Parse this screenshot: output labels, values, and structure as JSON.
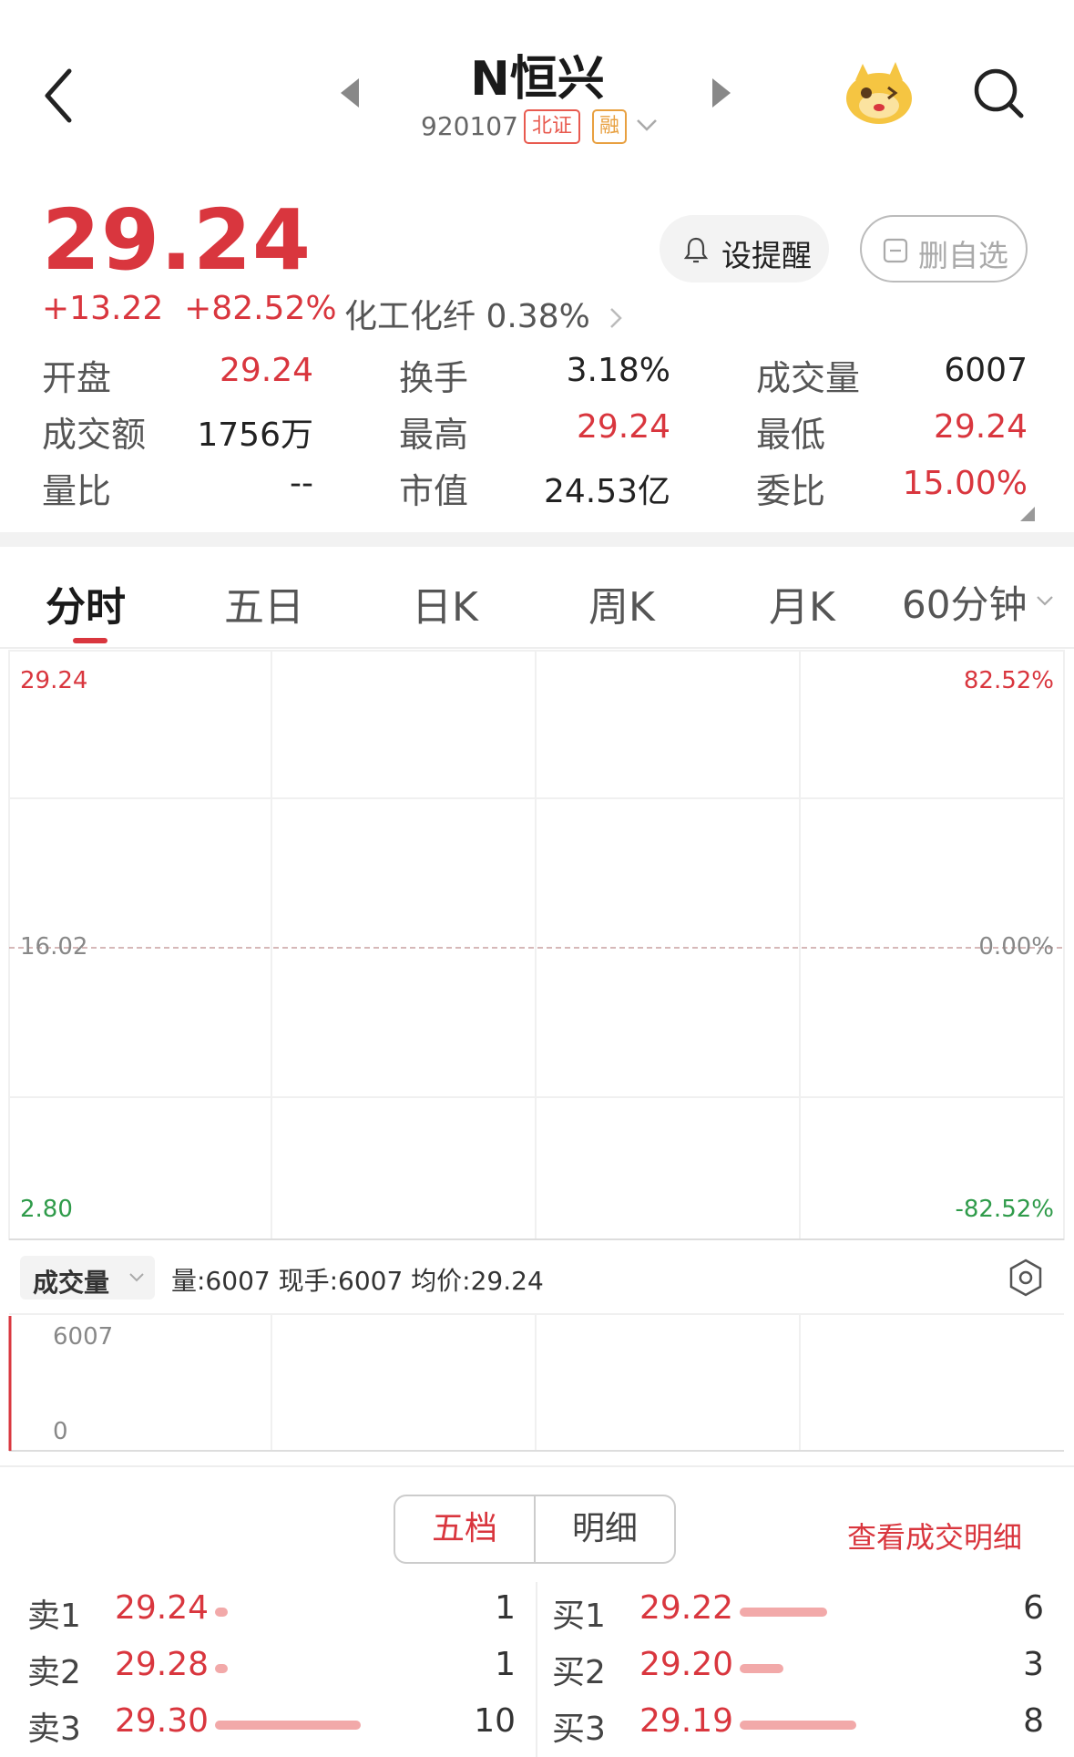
{
  "header": {
    "name": "N恒兴",
    "code": "920107",
    "exchange_badge": "北证",
    "margin_badge": "融"
  },
  "quote": {
    "price": "29.24",
    "change": "+13.22",
    "change_pct": "+82.52%",
    "industry": "化工化纤 0.38%",
    "alert_label": "设提醒",
    "remove_label": "删自选"
  },
  "stats": [
    {
      "label": "开盘",
      "value": "29.24",
      "color": "#d9363e"
    },
    {
      "label": "换手",
      "value": "3.18%",
      "color": "#222222"
    },
    {
      "label": "成交量",
      "value": "6007",
      "color": "#222222"
    },
    {
      "label": "成交额",
      "value": "1756万",
      "color": "#222222"
    },
    {
      "label": "最高",
      "value": "29.24",
      "color": "#d9363e"
    },
    {
      "label": "最低",
      "value": "29.24",
      "color": "#d9363e"
    },
    {
      "label": "量比",
      "value": "--",
      "color": "#222222"
    },
    {
      "label": "市值",
      "value": "24.53亿",
      "color": "#222222"
    },
    {
      "label": "委比",
      "value": "15.00%",
      "color": "#d9363e"
    }
  ],
  "tabs": [
    "分时",
    "五日",
    "日K",
    "周K",
    "月K",
    "60分钟"
  ],
  "active_tab": "分时",
  "chart": {
    "price_top": "29.24",
    "price_mid": "16.02",
    "price_bottom": "2.80",
    "pct_top": "82.52%",
    "pct_mid": "0.00%",
    "pct_bottom": "-82.52%"
  },
  "volume": {
    "selector": "成交量",
    "info": "量:6007  现手:6007  均价:29.24",
    "max_label": "6007",
    "min_label": "0"
  },
  "order_book": {
    "tab_active": "五档",
    "tab_other": "明细",
    "detail_link": "查看成交明细",
    "sells": [
      {
        "label": "卖1",
        "price": "29.24",
        "qty": "1",
        "bar": 0.08
      },
      {
        "label": "卖2",
        "price": "29.28",
        "qty": "1",
        "bar": 0.08
      },
      {
        "label": "卖3",
        "price": "29.30",
        "qty": "10",
        "bar": 1.0
      }
    ],
    "buys": [
      {
        "label": "买1",
        "price": "29.22",
        "qty": "6",
        "bar": 0.6
      },
      {
        "label": "买2",
        "price": "29.20",
        "qty": "3",
        "bar": 0.3
      },
      {
        "label": "买3",
        "price": "29.19",
        "qty": "8",
        "bar": 0.8
      }
    ]
  },
  "colors": {
    "up": "#d9363e",
    "down": "#2f9b4a",
    "accent": "#d9363e"
  }
}
